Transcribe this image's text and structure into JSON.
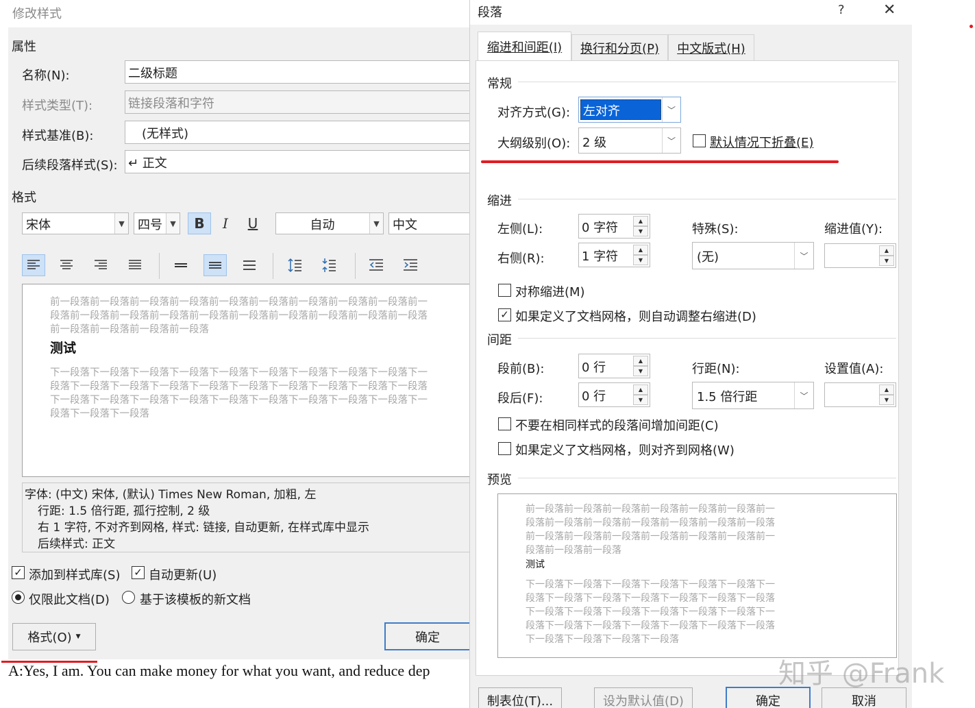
{
  "left_dialog": {
    "title": "修改样式",
    "properties_label": "属性",
    "name_label": "名称(N):",
    "name_value": "二级标题",
    "type_label": "样式类型(T):",
    "type_value": "链接段落和字符",
    "based_on_label": "样式基准(B):",
    "based_on_value": "(无样式)",
    "next_label": "后续段落样式(S):",
    "next_value": "↵ 正文",
    "format_label": "格式",
    "font": "宋体",
    "size": "四号",
    "bold": "B",
    "italic": "I",
    "underline": "U",
    "color": "自动",
    "script": "中文",
    "preview_before": [
      "前一段落前一段落前一段落前一段落前一段落前一段落前一段落前一段落前一段落前一",
      "段落前一段落前一段落前一段落前一段落前一段落前一段落前一段落前一段落前一段落",
      "前一段落前一段落前一段落前一段落"
    ],
    "preview_sample": "测试",
    "preview_after": [
      "下一段落下一段落下一段落下一段落下一段落下一段落下一段落下一段落下一段落下一",
      "段落下一段落下一段落下一段落下一段落下一段落下一段落下一段落下一段落下一段落",
      "下一段落下一段落下一段落下一段落下一段落下一段落下一段落下一段落下一段落下一",
      "段落下一段落下一段落"
    ],
    "description": [
      "字体: (中文) 宋体, (默认) Times New Roman, 加粗, 左",
      "行距: 1.5 倍行距, 孤行控制, 2 级",
      "右  1 字符, 不对齐到网格, 样式: 链接, 自动更新, 在样式库中显示",
      "后续样式: 正文"
    ],
    "add_to_gallery": "添加到样式库(S)",
    "auto_update": "自动更新(U)",
    "only_this_doc": "仅限此文档(D)",
    "new_docs_template": "基于该模板的新文档",
    "format_button": "格式(O)",
    "ok_button": "确定",
    "doc_text": "A:Yes, I am. You can make money for what you want, and reduce dep"
  },
  "right_dialog": {
    "title": "段落",
    "help": "?",
    "close": "✕",
    "tabs": [
      "缩进和间距(I)",
      "换行和分页(P)",
      "中文版式(H)"
    ],
    "general_label": "常规",
    "alignment_label": "对齐方式(G):",
    "alignment_value": "左对齐",
    "outline_label": "大纲级别(O):",
    "outline_value": "2 级",
    "collapse_label": "默认情况下折叠(E)",
    "indent_label": "缩进",
    "left_label": "左侧(L):",
    "left_value": "0 字符",
    "right_label": "右侧(R):",
    "right_value": "1 字符",
    "special_label": "特殊(S):",
    "special_value": "(无)",
    "indent_by_label": "缩进值(Y):",
    "indent_by_value": "",
    "mirror_label": "对称缩进(M)",
    "auto_adjust_label": "如果定义了文档网格，则自动调整右缩进(D)",
    "spacing_label": "间距",
    "before_label": "段前(B):",
    "before_value": "0 行",
    "after_label": "段后(F):",
    "after_value": "0 行",
    "line_spacing_label": "行距(N):",
    "line_spacing_value": "1.5 倍行距",
    "at_label": "设置值(A):",
    "at_value": "",
    "no_space_label": "不要在相同样式的段落间增加间距(C)",
    "snap_grid_label": "如果定义了文档网格，则对齐到网格(W)",
    "preview_label": "预览",
    "preview_before": [
      "前一段落前一段落前一段落前一段落前一段落前一段落前一",
      "段落前一段落前一段落前一段落前一段落前一段落前一段落",
      "前一段落前一段落前一段落前一段落前一段落前一段落前一",
      "段落前一段落前一段落"
    ],
    "preview_sample": "测试",
    "preview_after": [
      "下一段落下一段落下一段落下一段落下一段落下一段落下一",
      "段落下一段落下一段落下一段落下一段落下一段落下一段落",
      "下一段落下一段落下一段落下一段落下一段落下一段落下一",
      "段落下一段落下一段落下一段落下一段落下一段落下一段落",
      "下一段落下一段落下一段落下一段落"
    ],
    "tabs_button": "制表位(T)...",
    "set_default_button": "设为默认值(D)",
    "ok_button": "确定",
    "cancel_button": "取消"
  },
  "watermark": "知乎 @Frank",
  "colors": {
    "annotation_red": "#e11b22",
    "selection_blue": "#0a64d8",
    "toggle_on": "#cde1f7"
  }
}
